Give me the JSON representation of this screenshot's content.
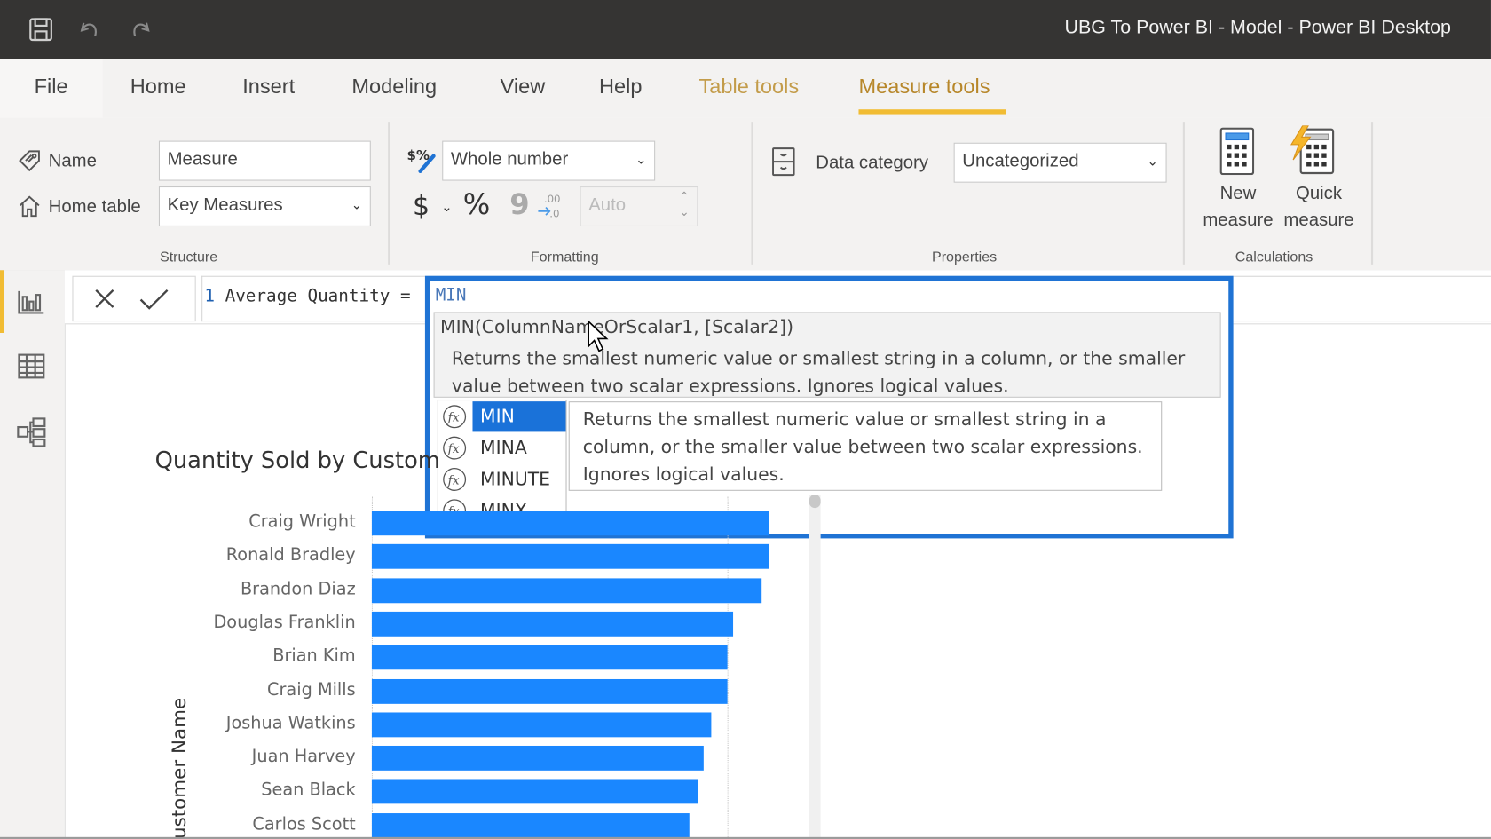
{
  "window": {
    "title": "UBG To Power BI - Model - Power BI Desktop"
  },
  "quick_access": {
    "save": "save-icon",
    "undo": "undo-icon",
    "redo": "redo-icon"
  },
  "tabs": [
    {
      "label": "File"
    },
    {
      "label": "Home"
    },
    {
      "label": "Insert"
    },
    {
      "label": "Modeling"
    },
    {
      "label": "View"
    },
    {
      "label": "Help"
    },
    {
      "label": "Table tools"
    },
    {
      "label": "Measure tools"
    }
  ],
  "active_tab": "Measure tools",
  "ribbon": {
    "structure": {
      "group_label": "Structure",
      "name_label": "Name",
      "name_value": "Measure",
      "home_table_label": "Home table",
      "home_table_value": "Key Measures"
    },
    "formatting": {
      "group_label": "Formatting",
      "format_value": "Whole number",
      "currency_symbol": "$",
      "percent_symbol": "%",
      "comma_symbol": "9",
      "decimal_symbol": ".00",
      "decimal_places_value": "Auto"
    },
    "properties": {
      "group_label": "Properties",
      "data_category_label": "Data category",
      "data_category_value": "Uncategorized"
    },
    "calculations": {
      "group_label": "Calculations",
      "new_measure_line1": "New",
      "new_measure_line2": "measure",
      "quick_measure_line1": "Quick",
      "quick_measure_line2": "measure"
    }
  },
  "left_rail": [
    {
      "name": "report-view",
      "icon": "bar-chart-icon",
      "active": true
    },
    {
      "name": "data-view",
      "icon": "table-grid-icon",
      "active": false
    },
    {
      "name": "model-view",
      "icon": "model-diagram-icon",
      "active": false
    }
  ],
  "formula_bar": {
    "line_number": "1",
    "text_prefix": " Average Quantity = ",
    "typed_text": "MIN",
    "cancel": "close-icon",
    "commit": "check-icon"
  },
  "intellisense": {
    "signature": "MIN(ColumnNameOrScalar1, [Scalar2])",
    "signature_description": "Returns the smallest numeric value or smallest string in a column, or the smaller value between two scalar expressions. Ignores logical values.",
    "items": [
      {
        "label": "MIN",
        "selected": true
      },
      {
        "label": "MINA",
        "selected": false
      },
      {
        "label": "MINUTE",
        "selected": false
      },
      {
        "label": "MINX",
        "selected": false
      }
    ],
    "item_description": "Returns the smallest numeric value or smallest string in a column, or the smaller value between two scalar expressions. Ignores logical values."
  },
  "colors": {
    "accent_tab": "#b7872a",
    "tab_underline": "#f1bc33",
    "highlight_border": "#1f73d4",
    "selected_item": "#1a72d9",
    "bar": "#1a87ff"
  },
  "chart_data": {
    "type": "bar",
    "orientation": "horizontal",
    "title": "Quantity Sold by Customer Name",
    "title_visible": "Quantity Sold by Custom",
    "xlabel": "",
    "ylabel": "Customer Name",
    "ylabel_visible": "ustomer Name",
    "categories": [
      "Craig Wright",
      "Ronald Bradley",
      "Brandon Diaz",
      "Douglas Franklin",
      "Brian Kim",
      "Craig Mills",
      "Joshua Watkins",
      "Juan Harvey",
      "Sean Black",
      "Carlos Scott"
    ],
    "values": [
      1.0,
      1.0,
      0.98,
      0.91,
      0.895,
      0.895,
      0.855,
      0.835,
      0.82,
      0.8
    ],
    "value_units": "relative to largest bar (no axis values shown)",
    "gridline_reference": 0.895,
    "grid": true,
    "legend": "none"
  }
}
